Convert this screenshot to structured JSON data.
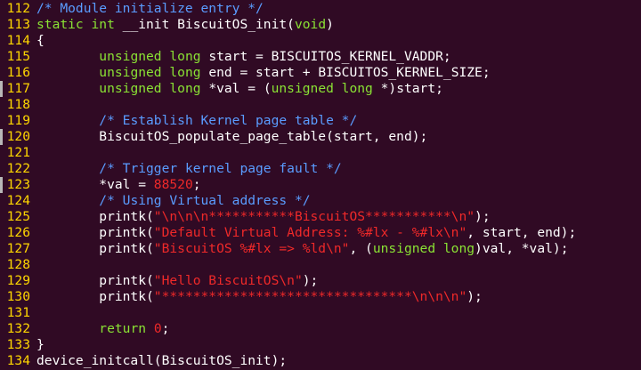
{
  "editor": {
    "colors": {
      "background": "#300a24",
      "line_number": "#ffd700",
      "plain": "#ffffff",
      "comment": "#5a9cff",
      "keyword": "#8ae234",
      "string": "#ef2929",
      "escape": "#ef2929",
      "marker": "#b8b8b8"
    },
    "lines": [
      {
        "num": "112",
        "marked": false,
        "tokens": [
          {
            "t": "/* Module initialize entry */",
            "c": "comment"
          }
        ]
      },
      {
        "num": "113",
        "marked": false,
        "tokens": [
          {
            "t": "static ",
            "c": "keyword"
          },
          {
            "t": "int",
            "c": "keyword"
          },
          {
            "t": " __init BiscuitOS_init(",
            "c": "plain"
          },
          {
            "t": "void",
            "c": "keyword"
          },
          {
            "t": ")",
            "c": "plain"
          }
        ]
      },
      {
        "num": "114",
        "marked": false,
        "tokens": [
          {
            "t": "{",
            "c": "plain"
          }
        ]
      },
      {
        "num": "115",
        "marked": false,
        "tokens": [
          {
            "t": "        ",
            "c": "plain"
          },
          {
            "t": "unsigned long",
            "c": "keyword"
          },
          {
            "t": " start = BISCUITOS_KERNEL_VADDR;",
            "c": "plain"
          }
        ]
      },
      {
        "num": "116",
        "marked": false,
        "tokens": [
          {
            "t": "        ",
            "c": "plain"
          },
          {
            "t": "unsigned long",
            "c": "keyword"
          },
          {
            "t": " end = start + BISCUITOS_KERNEL_SIZE;",
            "c": "plain"
          }
        ]
      },
      {
        "num": "117",
        "marked": true,
        "tokens": [
          {
            "t": "        ",
            "c": "plain"
          },
          {
            "t": "unsigned long",
            "c": "keyword"
          },
          {
            "t": " *val = (",
            "c": "plain"
          },
          {
            "t": "unsigned long",
            "c": "keyword"
          },
          {
            "t": " *)start;",
            "c": "plain"
          }
        ]
      },
      {
        "num": "118",
        "marked": false,
        "tokens": []
      },
      {
        "num": "119",
        "marked": false,
        "tokens": [
          {
            "t": "        ",
            "c": "plain"
          },
          {
            "t": "/* Establish Kernel page table */",
            "c": "comment"
          }
        ]
      },
      {
        "num": "120",
        "marked": true,
        "tokens": [
          {
            "t": "        BiscuitOS_populate_page_table(start, end);",
            "c": "plain"
          }
        ]
      },
      {
        "num": "121",
        "marked": false,
        "tokens": []
      },
      {
        "num": "122",
        "marked": false,
        "tokens": [
          {
            "t": "        ",
            "c": "plain"
          },
          {
            "t": "/* Trigger kernel page fault */",
            "c": "comment"
          }
        ]
      },
      {
        "num": "123",
        "marked": true,
        "tokens": [
          {
            "t": "        *val = ",
            "c": "plain"
          },
          {
            "t": "88520",
            "c": "string"
          },
          {
            "t": ";",
            "c": "plain"
          }
        ]
      },
      {
        "num": "124",
        "marked": false,
        "tokens": [
          {
            "t": "        ",
            "c": "plain"
          },
          {
            "t": "/* Using Virtual address */",
            "c": "comment"
          }
        ]
      },
      {
        "num": "125",
        "marked": false,
        "tokens": [
          {
            "t": "        printk(",
            "c": "plain"
          },
          {
            "t": "\"\\n\\n\\n***********BiscuitOS***********\\n\"",
            "c": "string"
          },
          {
            "t": ");",
            "c": "plain"
          }
        ]
      },
      {
        "num": "126",
        "marked": false,
        "tokens": [
          {
            "t": "        printk(",
            "c": "plain"
          },
          {
            "t": "\"Default Virtual Address: %#lx - %#lx\\n\"",
            "c": "string"
          },
          {
            "t": ", start, end);",
            "c": "plain"
          }
        ]
      },
      {
        "num": "127",
        "marked": false,
        "tokens": [
          {
            "t": "        printk(",
            "c": "plain"
          },
          {
            "t": "\"BiscuitOS %#lx => %ld\\n\"",
            "c": "string"
          },
          {
            "t": ", (",
            "c": "plain"
          },
          {
            "t": "unsigned long",
            "c": "keyword"
          },
          {
            "t": ")val, *val);",
            "c": "plain"
          }
        ]
      },
      {
        "num": "128",
        "marked": false,
        "tokens": []
      },
      {
        "num": "129",
        "marked": false,
        "tokens": [
          {
            "t": "        printk(",
            "c": "plain"
          },
          {
            "t": "\"Hello BiscuitOS\\n\"",
            "c": "string"
          },
          {
            "t": ");",
            "c": "plain"
          }
        ]
      },
      {
        "num": "130",
        "marked": false,
        "tokens": [
          {
            "t": "        printk(",
            "c": "plain"
          },
          {
            "t": "\"********************************\\n\\n\\n\"",
            "c": "string"
          },
          {
            "t": ");",
            "c": "plain"
          }
        ]
      },
      {
        "num": "131",
        "marked": false,
        "tokens": []
      },
      {
        "num": "132",
        "marked": false,
        "tokens": [
          {
            "t": "        ",
            "c": "plain"
          },
          {
            "t": "return",
            "c": "keyword"
          },
          {
            "t": " ",
            "c": "plain"
          },
          {
            "t": "0",
            "c": "string"
          },
          {
            "t": ";",
            "c": "plain"
          }
        ]
      },
      {
        "num": "133",
        "marked": false,
        "tokens": [
          {
            "t": "}",
            "c": "plain"
          }
        ]
      },
      {
        "num": "134",
        "marked": false,
        "tokens": [
          {
            "t": "device_initcall(BiscuitOS_init);",
            "c": "plain"
          }
        ]
      }
    ]
  }
}
